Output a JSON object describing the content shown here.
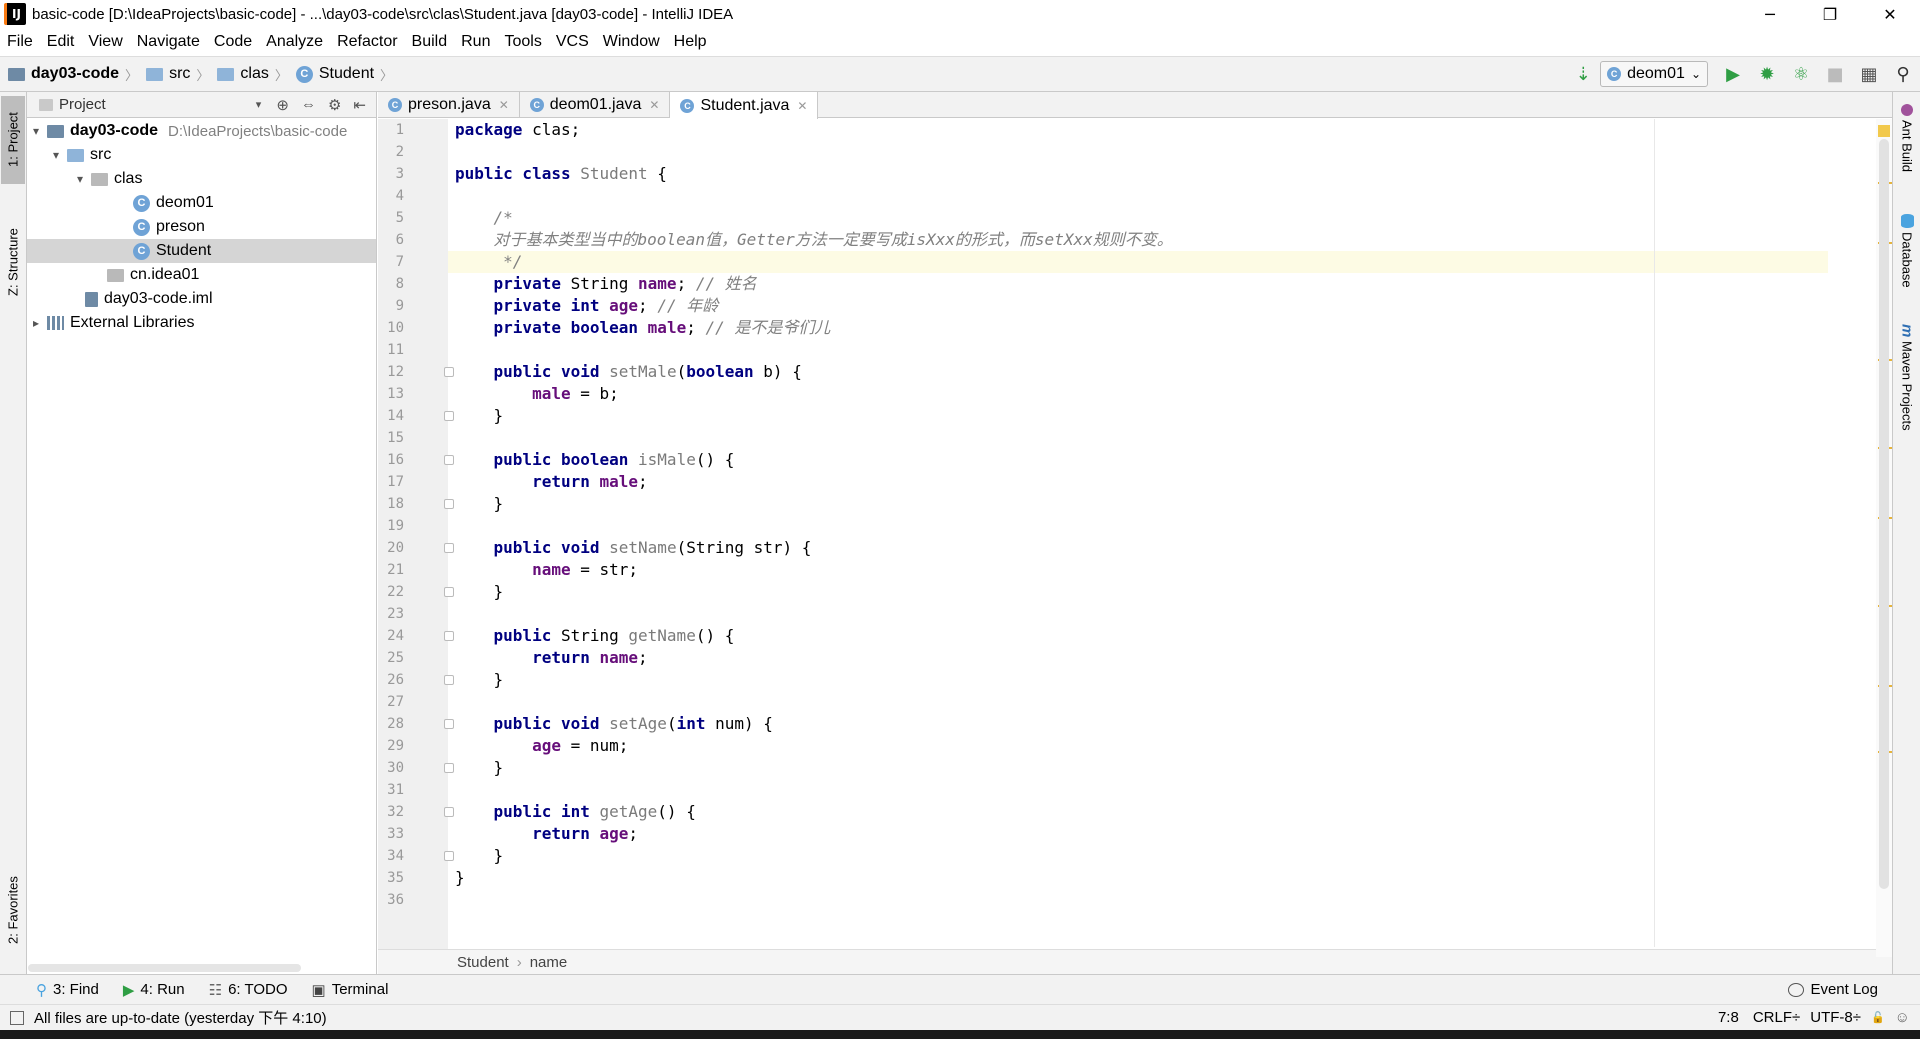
{
  "window": {
    "title": "basic-code [D:\\IdeaProjects\\basic-code] - ...\\day03-code\\src\\clas\\Student.java [day03-code] - IntelliJ IDEA",
    "logo": "IJ",
    "controls": {
      "minimize": "─",
      "restore": "❐",
      "close": "✕"
    }
  },
  "menu": [
    "File",
    "Edit",
    "View",
    "Navigate",
    "Code",
    "Analyze",
    "Refactor",
    "Build",
    "Run",
    "Tools",
    "VCS",
    "Window",
    "Help"
  ],
  "nav": {
    "crumbs": [
      "day03-code",
      "src",
      "clas",
      "Student"
    ],
    "run_config": "deom01",
    "sep": "〉",
    "cfg_arrow": "⌄",
    "icons": {
      "vcs": "⇣",
      "run": "▶",
      "debug": "✹",
      "coverage": "⚛",
      "stop": "■",
      "structure": "▦",
      "search": "⚲"
    }
  },
  "left_strip": {
    "project": "1: Project",
    "structure": "Z: Structure",
    "favorites": "2: Favorites"
  },
  "project_panel": {
    "header": "Project",
    "header_arrow": "▾",
    "tools": {
      "locate": "⊕",
      "collapse": "⇔",
      "settings": "⚙",
      "hide": "⇤"
    },
    "tree": [
      {
        "label": "day03-code",
        "path": "D:\\IdeaProjects\\basic-code",
        "arrow": "▾"
      },
      {
        "label": "src",
        "arrow": "▾"
      },
      {
        "label": "clas",
        "arrow": "▾"
      },
      {
        "label": "deom01",
        "icon": "C"
      },
      {
        "label": "preson",
        "icon": "C"
      },
      {
        "label": "Student",
        "icon": "C"
      },
      {
        "label": "cn.idea01"
      },
      {
        "label": "day03-code.iml"
      },
      {
        "label": "External Libraries",
        "arrow": "▸"
      }
    ]
  },
  "tabs": [
    {
      "label": "preson.java",
      "icon": "C",
      "close": "✕"
    },
    {
      "label": "deom01.java",
      "icon": "C",
      "close": "✕"
    },
    {
      "label": "Student.java",
      "icon": "C",
      "close": "✕"
    }
  ],
  "editor": {
    "cursor_line": 7,
    "line_count": 36,
    "breadcrumb": [
      "Student",
      "name"
    ],
    "breadcrumb_sep": "›"
  },
  "code": {
    "l1_kw": "package",
    "l1_rest": " clas;",
    "l3_kw": "public class",
    "l3_name": "Student",
    "l3_rest": " {",
    "l5": "/*",
    "l6": "对于基本类型当中的boolean值，Getter方法一定要写成isXxx的形式，而setXxx规则不变。",
    "l7": " */",
    "l8_kw": "private",
    "l8_type": " String ",
    "l8_field": "name",
    "l8_rest": "; ",
    "l8_cm": "// 姓名",
    "l9_kw": "private int",
    "l9_field": "age",
    "l9_rest": "; ",
    "l9_cm": "// 年龄",
    "l10_kw": "private boolean",
    "l10_field": "male",
    "l10_rest": "; ",
    "l10_cm": "// 是不是爷们儿",
    "l12_kw": "public void",
    "l12_fn": "setMale",
    "l12_p1": "(",
    "l12_pkw": "boolean",
    "l12_p2": " b) {",
    "l13_field": "male",
    "l13_rest": " = b;",
    "close": "}",
    "l16_kw": "public boolean",
    "l16_fn": "isMale",
    "l16_rest": "() {",
    "ret_kw": "return",
    "l17_field": "male",
    "semi": ";",
    "l20_kw": "public void",
    "l20_fn": "setName",
    "l20_rest": "(String str) {",
    "l21_field": "name",
    "l21_rest": " = str;",
    "l24_kw": "public",
    "l24_type": " String ",
    "l24_fn": "getName",
    "l24_rest": "() {",
    "l25_field": "name",
    "l28_kw": "public void",
    "l28_fn": "setAge",
    "l28_p1": "(",
    "l28_pkw": "int",
    "l28_p2": " num) {",
    "l29_field": "age",
    "l29_rest": " = num;",
    "l32_kw": "public int",
    "l32_fn": "getAge",
    "l32_rest": "() {",
    "l33_field": "age"
  },
  "right_strip": {
    "ant": "Ant Build",
    "db": "Database",
    "maven": "Maven Projects",
    "maven_icon": "m"
  },
  "toolwindows": [
    {
      "label": "3: Find",
      "icon": "⚲"
    },
    {
      "label": "4: Run",
      "icon": "▶"
    },
    {
      "label": "6: TODO",
      "icon": "☷"
    },
    {
      "label": "Terminal",
      "icon": "▣"
    }
  ],
  "event_log": "Event Log",
  "status": {
    "message": "All files are up-to-date (yesterday 下午 4:10)",
    "position": "7:8",
    "line_sep": "CRLF÷",
    "encoding": "UTF-8÷",
    "lock_icon": "🔓",
    "hector_icon": "☺"
  },
  "colors": {
    "keyword": "#000080",
    "field": "#660e7a",
    "comment": "#808080",
    "accent": "#6fa3d6",
    "run_green": "#2f9e44"
  }
}
